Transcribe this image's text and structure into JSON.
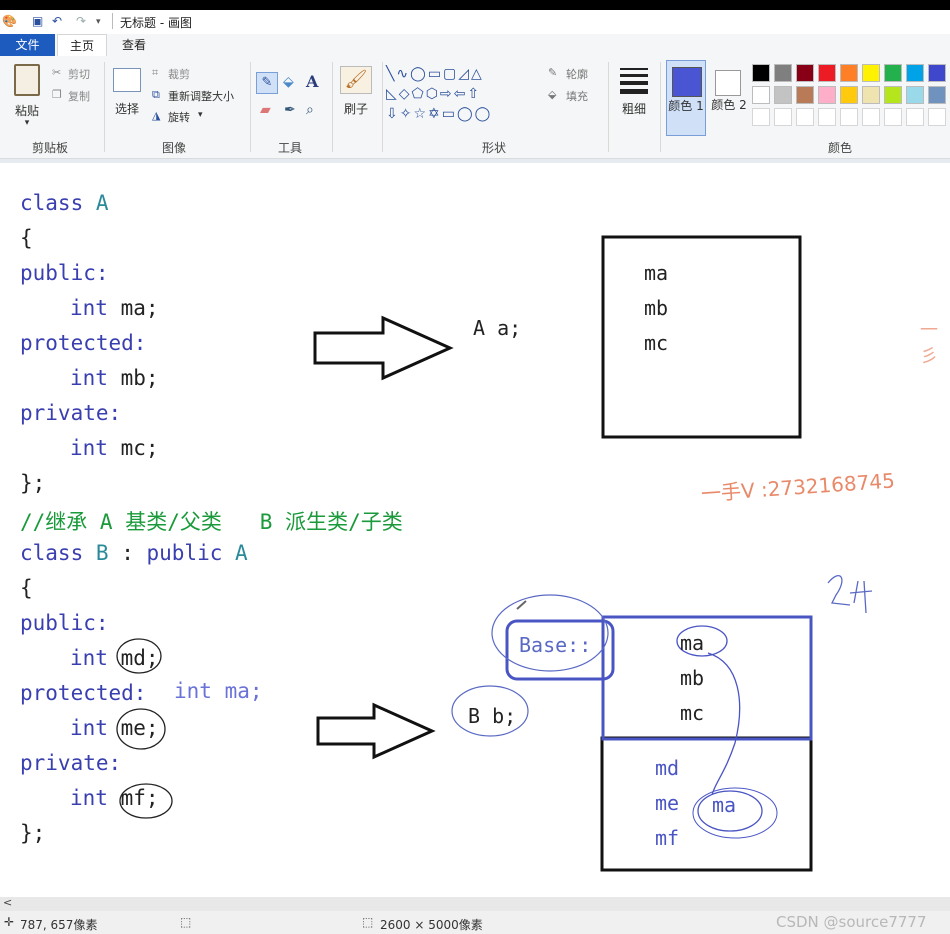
{
  "window": {
    "title": "无标题 - 画图"
  },
  "tabs": {
    "file": "文件",
    "home": "主页",
    "view": "查看"
  },
  "ribbon": {
    "clipboard": {
      "paste": "粘贴",
      "cut": "剪切",
      "copy": "复制",
      "group": "剪贴板"
    },
    "image": {
      "select": "选择",
      "crop": "裁剪",
      "resize": "重新调整大小",
      "rotate": "旋转",
      "group": "图像"
    },
    "tools": {
      "group": "工具"
    },
    "brush": {
      "label": "刷子"
    },
    "shapes": {
      "outline": "轮廓",
      "fill": "填充",
      "group": "形状"
    },
    "size": {
      "label": "粗细"
    },
    "color1": {
      "label": "颜色 1",
      "value": "#4a55d4"
    },
    "color2": {
      "label": "颜色 2",
      "value": "#ffffff"
    },
    "colors": {
      "group": "颜色",
      "row1": [
        "#000000",
        "#7f7f7f",
        "#880015",
        "#ed1c24",
        "#ff7f27",
        "#fff200",
        "#22b14c",
        "#00a2e8",
        "#3f48cc"
      ],
      "row2": [
        "#ffffff",
        "#c3c3c3",
        "#b97a57",
        "#ffaec9",
        "#ffc90e",
        "#efe4b0",
        "#b5e61d",
        "#99d9ea",
        "#7092be"
      ]
    }
  },
  "code": {
    "l1_kw": "class",
    "l1_name": "A",
    "l2": "{",
    "l3": "public:",
    "l4_kw": "int",
    "l4_var": "ma;",
    "l5": "protected:",
    "l6_kw": "int",
    "l6_var": "mb;",
    "l7": "private:",
    "l8_kw": "int",
    "l8_var": "mc;",
    "l9": "};",
    "l10": "//继承 A 基类/父类   B 派生类/子类",
    "l11_kw": "class",
    "l11_name": "B",
    "l11_colon": ":",
    "l11_pub": "public",
    "l11_base": "A",
    "l12": "{",
    "l13": "public:",
    "l14_kw": "int",
    "l14_var": "md;",
    "l15": "protected:",
    "l15_extra": "int ma;",
    "l16_kw": "int",
    "l16_var": "me;",
    "l17": "private:",
    "l18_kw": "int",
    "l18_var": "mf;",
    "l19": "};"
  },
  "diagram": {
    "obj_a": "A a;",
    "box_a": [
      "ma",
      "mb",
      "mc"
    ],
    "obj_b": "B b;",
    "base_label": "Base::",
    "box_b_base": [
      "ma",
      "mb",
      "mc"
    ],
    "box_b_derived": [
      "md",
      "me",
      "mf"
    ],
    "circled": "ma",
    "annotation_num": "24",
    "contact": "一手V :2732168745",
    "edge_note": "一彡"
  },
  "status": {
    "cursor": "787, 657像素",
    "canvas_size": "2600 × 5000像素",
    "watermark": "CSDN @source7777"
  }
}
